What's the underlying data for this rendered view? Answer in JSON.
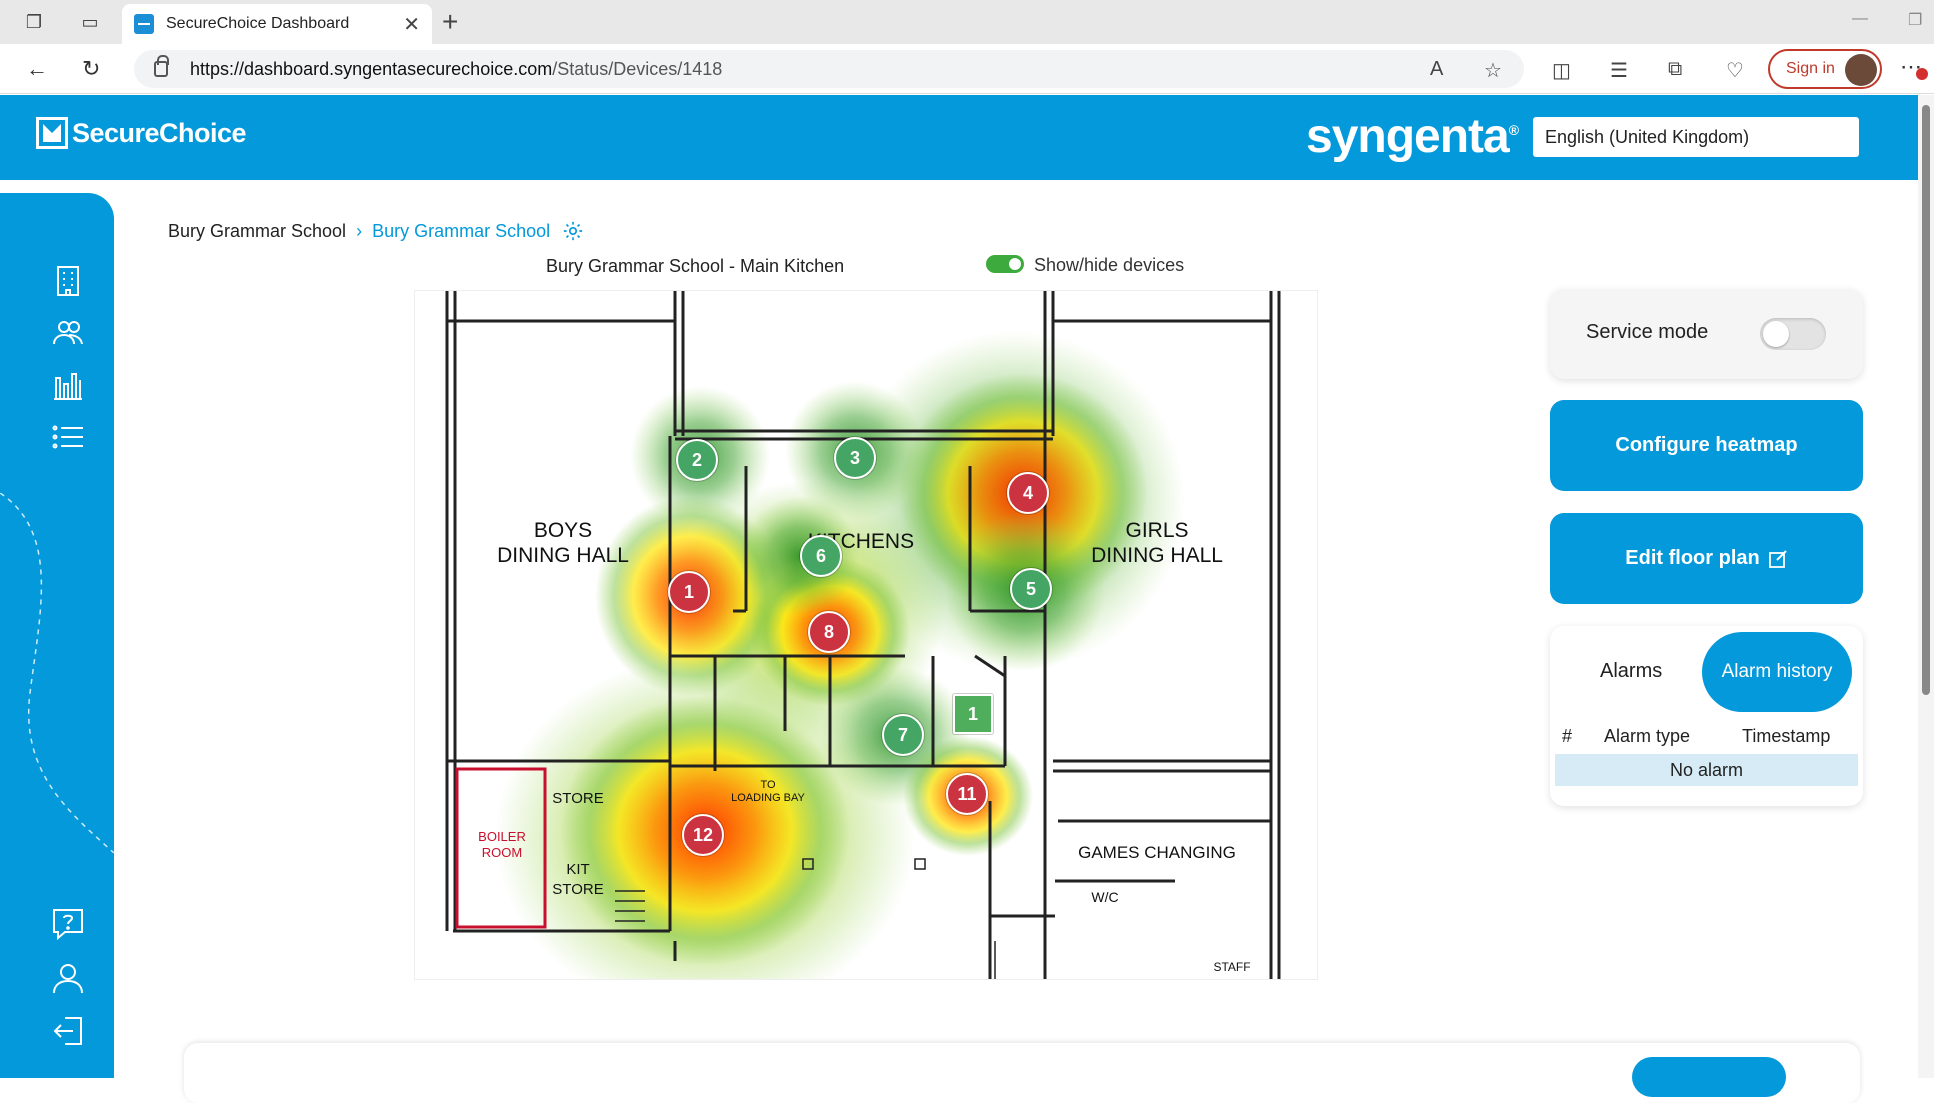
{
  "browser": {
    "tab_title": "SecureChoice Dashboard",
    "url_host": "https://dashboard.syngentasecurechoice.com",
    "url_path": "/Status/Devices/1418",
    "sign_in": "Sign in"
  },
  "header": {
    "logo": "SecureChoice",
    "brand": "syngenta",
    "language": "English (United Kingdom)"
  },
  "breadcrumb": {
    "parent": "Bury Grammar School",
    "current": "Bury Grammar School"
  },
  "floorplan": {
    "title": "Bury Grammar School - Main Kitchen",
    "toggle_label": "Show/hide devices",
    "rooms": {
      "boys": "BOYS",
      "boys2": "DINING HALL",
      "girls": "GIRLS",
      "girls2": "DINING HALL",
      "kitchens": "KITCHENS",
      "store": "STORE",
      "kit_store": "KIT",
      "kit_store2": "STORE",
      "boiler": "BOILER",
      "boiler2": "ROOM",
      "loading": "TO",
      "loading2": "LOADING BAY",
      "games": "GAMES CHANGING",
      "wc": "W/C",
      "staff": "STAFF"
    },
    "devices": [
      {
        "label": "1",
        "status": "red"
      },
      {
        "label": "2",
        "status": "green"
      },
      {
        "label": "3",
        "status": "green"
      },
      {
        "label": "4",
        "status": "red"
      },
      {
        "label": "5",
        "status": "green"
      },
      {
        "label": "6",
        "status": "green"
      },
      {
        "label": "7",
        "status": "green"
      },
      {
        "label": "8",
        "status": "red"
      },
      {
        "label": "11",
        "status": "red"
      },
      {
        "label": "12",
        "status": "red"
      },
      {
        "label": "1",
        "status": "green-square"
      }
    ]
  },
  "panel": {
    "service_mode": "Service mode",
    "configure_heatmap": "Configure heatmap",
    "edit_floor_plan": "Edit floor plan",
    "alarms_tab": "Alarms",
    "alarm_history_tab": "Alarm history",
    "col_hash": "#",
    "col_type": "Alarm type",
    "col_timestamp": "Timestamp",
    "no_alarm": "No alarm"
  },
  "colors": {
    "primary": "#0399da",
    "green_device": "#44a564",
    "red_device": "#cc3340"
  }
}
